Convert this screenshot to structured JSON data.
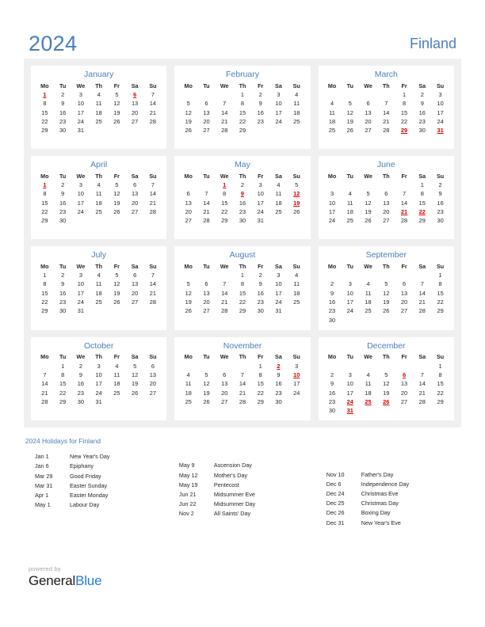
{
  "header": {
    "year": "2024",
    "country": "Finland"
  },
  "theme": {
    "accent": "#4a7ebb",
    "holiday": "#d60000",
    "panel_bg": "#f0f0f0",
    "card_bg": "#ffffff",
    "text": "#262626",
    "logo_blue": "#1f7fd4"
  },
  "weekday_headers": [
    "Mo",
    "Tu",
    "We",
    "Th",
    "Fr",
    "Sa",
    "Su"
  ],
  "months": [
    {
      "name": "January",
      "weeks": [
        [
          "1",
          "2",
          "3",
          "4",
          "5",
          "6",
          "7"
        ],
        [
          "8",
          "9",
          "10",
          "11",
          "12",
          "13",
          "14"
        ],
        [
          "15",
          "16",
          "17",
          "18",
          "19",
          "20",
          "21"
        ],
        [
          "22",
          "23",
          "24",
          "25",
          "26",
          "27",
          "28"
        ],
        [
          "29",
          "30",
          "31",
          "",
          "",
          "",
          ""
        ]
      ],
      "holidays": [
        "1",
        "6"
      ]
    },
    {
      "name": "February",
      "weeks": [
        [
          "",
          "",
          "",
          "1",
          "2",
          "3",
          "4"
        ],
        [
          "5",
          "6",
          "7",
          "8",
          "9",
          "10",
          "11"
        ],
        [
          "12",
          "13",
          "14",
          "15",
          "16",
          "17",
          "18"
        ],
        [
          "19",
          "20",
          "21",
          "22",
          "23",
          "24",
          "25"
        ],
        [
          "26",
          "27",
          "28",
          "29",
          "",
          "",
          ""
        ]
      ],
      "holidays": []
    },
    {
      "name": "March",
      "weeks": [
        [
          "",
          "",
          "",
          "",
          "1",
          "2",
          "3"
        ],
        [
          "4",
          "5",
          "6",
          "7",
          "8",
          "9",
          "10"
        ],
        [
          "11",
          "12",
          "13",
          "14",
          "15",
          "16",
          "17"
        ],
        [
          "18",
          "19",
          "20",
          "21",
          "22",
          "23",
          "24"
        ],
        [
          "25",
          "26",
          "27",
          "28",
          "29",
          "30",
          "31"
        ]
      ],
      "holidays": [
        "29",
        "31"
      ]
    },
    {
      "name": "April",
      "weeks": [
        [
          "1",
          "2",
          "3",
          "4",
          "5",
          "6",
          "7"
        ],
        [
          "8",
          "9",
          "10",
          "11",
          "12",
          "13",
          "14"
        ],
        [
          "15",
          "16",
          "17",
          "18",
          "19",
          "20",
          "21"
        ],
        [
          "22",
          "23",
          "24",
          "25",
          "26",
          "27",
          "28"
        ],
        [
          "29",
          "30",
          "",
          "",
          "",
          "",
          ""
        ]
      ],
      "holidays": [
        "1"
      ]
    },
    {
      "name": "May",
      "weeks": [
        [
          "",
          "",
          "1",
          "2",
          "3",
          "4",
          "5"
        ],
        [
          "6",
          "7",
          "8",
          "9",
          "10",
          "11",
          "12"
        ],
        [
          "13",
          "14",
          "15",
          "16",
          "17",
          "18",
          "19"
        ],
        [
          "20",
          "21",
          "22",
          "23",
          "24",
          "25",
          "26"
        ],
        [
          "27",
          "28",
          "29",
          "30",
          "31",
          "",
          ""
        ]
      ],
      "holidays": [
        "1",
        "9",
        "12",
        "19"
      ]
    },
    {
      "name": "June",
      "weeks": [
        [
          "",
          "",
          "",
          "",
          "",
          "1",
          "2"
        ],
        [
          "3",
          "4",
          "5",
          "6",
          "7",
          "8",
          "9"
        ],
        [
          "10",
          "11",
          "12",
          "13",
          "14",
          "15",
          "16"
        ],
        [
          "17",
          "18",
          "19",
          "20",
          "21",
          "22",
          "23"
        ],
        [
          "24",
          "25",
          "26",
          "27",
          "28",
          "29",
          "30"
        ]
      ],
      "holidays": [
        "21",
        "22"
      ]
    },
    {
      "name": "July",
      "weeks": [
        [
          "1",
          "2",
          "3",
          "4",
          "5",
          "6",
          "7"
        ],
        [
          "8",
          "9",
          "10",
          "11",
          "12",
          "13",
          "14"
        ],
        [
          "15",
          "16",
          "17",
          "18",
          "19",
          "20",
          "21"
        ],
        [
          "22",
          "23",
          "24",
          "25",
          "26",
          "27",
          "28"
        ],
        [
          "29",
          "30",
          "31",
          "",
          "",
          "",
          ""
        ]
      ],
      "holidays": []
    },
    {
      "name": "August",
      "weeks": [
        [
          "",
          "",
          "",
          "1",
          "2",
          "3",
          "4"
        ],
        [
          "5",
          "6",
          "7",
          "8",
          "9",
          "10",
          "11"
        ],
        [
          "12",
          "13",
          "14",
          "15",
          "16",
          "17",
          "18"
        ],
        [
          "19",
          "20",
          "21",
          "22",
          "23",
          "24",
          "25"
        ],
        [
          "26",
          "27",
          "28",
          "29",
          "30",
          "31",
          ""
        ]
      ],
      "holidays": []
    },
    {
      "name": "September",
      "weeks": [
        [
          "",
          "",
          "",
          "",
          "",
          "",
          "1"
        ],
        [
          "2",
          "3",
          "4",
          "5",
          "6",
          "7",
          "8"
        ],
        [
          "9",
          "10",
          "11",
          "12",
          "13",
          "14",
          "15"
        ],
        [
          "16",
          "17",
          "18",
          "19",
          "20",
          "21",
          "22"
        ],
        [
          "23",
          "24",
          "25",
          "26",
          "27",
          "28",
          "29"
        ],
        [
          "30",
          "",
          "",
          "",
          "",
          "",
          ""
        ]
      ],
      "holidays": []
    },
    {
      "name": "October",
      "weeks": [
        [
          "",
          "1",
          "2",
          "3",
          "4",
          "5",
          "6"
        ],
        [
          "7",
          "8",
          "9",
          "10",
          "11",
          "12",
          "13"
        ],
        [
          "14",
          "15",
          "16",
          "17",
          "18",
          "19",
          "20"
        ],
        [
          "21",
          "22",
          "23",
          "24",
          "25",
          "26",
          "27"
        ],
        [
          "28",
          "29",
          "30",
          "31",
          "",
          "",
          ""
        ]
      ],
      "holidays": []
    },
    {
      "name": "November",
      "weeks": [
        [
          "",
          "",
          "",
          "",
          "1",
          "2",
          "3"
        ],
        [
          "4",
          "5",
          "6",
          "7",
          "8",
          "9",
          "10"
        ],
        [
          "11",
          "12",
          "13",
          "14",
          "15",
          "16",
          "17"
        ],
        [
          "18",
          "19",
          "20",
          "21",
          "22",
          "23",
          "24"
        ],
        [
          "25",
          "26",
          "27",
          "28",
          "29",
          "30",
          ""
        ]
      ],
      "holidays": [
        "2",
        "10"
      ]
    },
    {
      "name": "December",
      "weeks": [
        [
          "",
          "",
          "",
          "",
          "",
          "",
          "1"
        ],
        [
          "2",
          "3",
          "4",
          "5",
          "6",
          "7",
          "8"
        ],
        [
          "9",
          "10",
          "11",
          "12",
          "13",
          "14",
          "15"
        ],
        [
          "16",
          "17",
          "18",
          "19",
          "20",
          "21",
          "22"
        ],
        [
          "23",
          "24",
          "25",
          "26",
          "27",
          "28",
          "29"
        ],
        [
          "30",
          "31",
          "",
          "",
          "",
          "",
          ""
        ]
      ],
      "holidays": [
        "6",
        "24",
        "25",
        "26",
        "31"
      ]
    }
  ],
  "holidays_section": {
    "title": "2024 Holidays for Finland",
    "columns": [
      {
        "leading_blank_rows": 0,
        "items": [
          {
            "date": "Jan 1",
            "name": "New Year's Day"
          },
          {
            "date": "Jan 6",
            "name": "Epiphany"
          },
          {
            "date": "Mar 29",
            "name": "Good Friday"
          },
          {
            "date": "Mar 31",
            "name": "Easter Sunday"
          },
          {
            "date": "Apr 1",
            "name": "Easter Monday"
          },
          {
            "date": "May 1",
            "name": "Labour Day"
          }
        ]
      },
      {
        "leading_blank_rows": 1,
        "items": [
          {
            "date": "May 9",
            "name": "Ascension Day"
          },
          {
            "date": "May 12",
            "name": "Mother's Day"
          },
          {
            "date": "May 19",
            "name": "Pentecost"
          },
          {
            "date": "Jun 21",
            "name": "Midsummer Eve"
          },
          {
            "date": "Jun 22",
            "name": "Midsummer Day"
          },
          {
            "date": "Nov 2",
            "name": "All Saints' Day"
          }
        ]
      },
      {
        "leading_blank_rows": 2,
        "items": [
          {
            "date": "Nov 10",
            "name": "Father's Day"
          },
          {
            "date": "Dec 6",
            "name": "Independence Day"
          },
          {
            "date": "Dec 24",
            "name": "Christmas Eve"
          },
          {
            "date": "Dec 25",
            "name": "Christmas Day"
          },
          {
            "date": "Dec 26",
            "name": "Boxing Day"
          },
          {
            "date": "Dec 31",
            "name": "New Year's Eve"
          }
        ]
      }
    ]
  },
  "footer": {
    "powered_by": "powered by",
    "brand_first": "General",
    "brand_second": "Blue"
  }
}
